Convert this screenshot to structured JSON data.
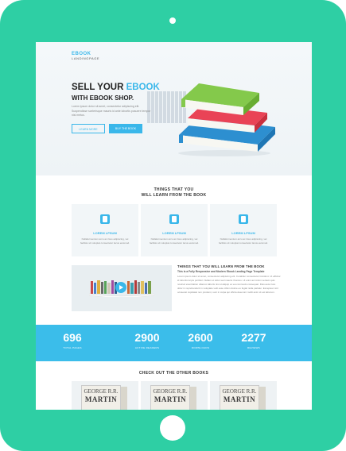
{
  "brand": {
    "top": "EBOOK",
    "bottom": "LANDINGPAGE"
  },
  "hero": {
    "title_plain": "SELL YOUR ",
    "title_accent": "EBOOK",
    "title_line2": "WITH EBOOK SHOP.",
    "description": "Lorem ipsum dolor sit amet, consectetur adipiscing elit. Suspendisse scelerisque mauris id ante lobortis posuere tempor nisi metus.",
    "button_learn": "LEARN MORE",
    "button_buy": "BUY THE BOOK"
  },
  "features": {
    "title_line1": "THINGS THAT YOU",
    "title_line2": "WILL LEARN FROM THE BOOK",
    "cards": [
      {
        "icon": "book-icon",
        "title": "LOREM LPSUM",
        "desc": "Nullafermentum arcu ac risus adipiscing, vel facilisis sit voluptat consectetur lacus euismod."
      },
      {
        "icon": "book-icon",
        "title": "LOREM LPSUM",
        "desc": "Nullafermentum arcu ac risus adipiscing, vel facilisis sit voluptat consectetur lacus euismod."
      },
      {
        "icon": "book-icon",
        "title": "LOREM LPSUM",
        "desc": "Nullafermentum arcu ac risus adipiscing, vel facilisis sit voluptat consectetur lacus euismod."
      }
    ]
  },
  "info": {
    "title": "THINGS THAT YOU WILL LEARN FROM THE BOOK",
    "subtitle": "This is a Fully Responsive and Modern Ebook Landing Page Template",
    "description": "Lorem ipsum dolor sit amet, consectetur adipiscing elit. Curabitur consectetur tincidunt. Ut efficitur id lobortis turpis porttitor. Nullam ut dolor sed mauris rhoncus. Ut enim ad minim veniam quis nostrud exercitation ullamco laboris nisi ut aliquip ex ea commodo consequat. Duis aute irure dolor in reprehenderit in voluptate velit esse cillum dolore eu fugiat nulla pariatur. Excepteur sint occaecat cupidatat non proident, sunt in culpa qui officia deserunt mollit anim id est laborum."
  },
  "stats": [
    {
      "value": "696",
      "label": "TOTAL PAGES"
    },
    {
      "value": "2900",
      "label": "ACTIVE READERS"
    },
    {
      "value": "2600",
      "label": "DOWNLOADS"
    },
    {
      "value": "2277",
      "label": "REVIEWS"
    }
  ],
  "other_books": {
    "title": "CHECK OUT THE OTHER BOOKS",
    "books": [
      {
        "author_line1": "GEORGE R.R.",
        "author_line2": "MARTIN"
      },
      {
        "author_line1": "GEORGE R.R.",
        "author_line2": "MARTIN"
      },
      {
        "author_line1": "GEORGE R.R.",
        "author_line2": "MARTIN"
      }
    ]
  },
  "colors": {
    "frame": "#2ecfa4",
    "accent": "#3ab7ea",
    "stats_bg": "#3bbdea"
  }
}
